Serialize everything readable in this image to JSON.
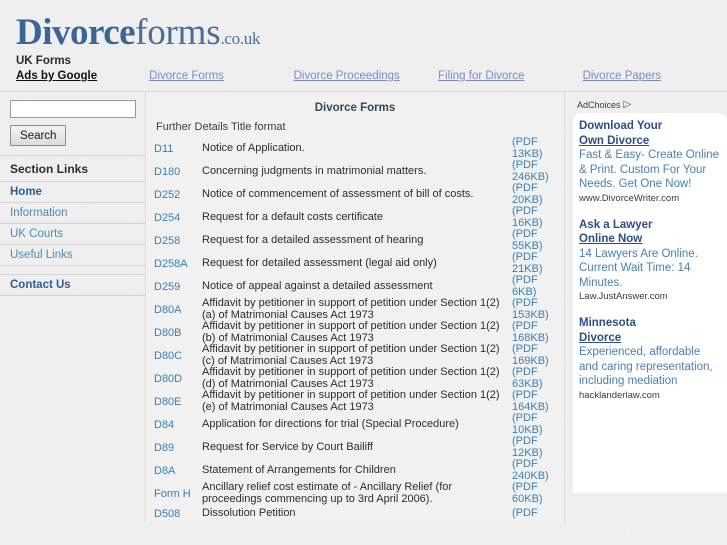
{
  "site": {
    "logo_primary": "Divorce",
    "logo_secondary": "forms",
    "logo_tld": ".co.uk"
  },
  "adnav": {
    "title": "UK Forms",
    "brand": "Ads by Google",
    "links": [
      "Divorce Forms",
      "Divorce Proceedings",
      "Filing for Divorce",
      "Divorce Papers"
    ]
  },
  "sidebar": {
    "search": {
      "value": "",
      "placeholder": "",
      "button_label": "Search"
    },
    "heading": "Section Links",
    "items": [
      {
        "label": "Home",
        "strong": true
      },
      {
        "label": "Information",
        "strong": false
      },
      {
        "label": "UK Courts",
        "strong": false
      },
      {
        "label": "Useful Links",
        "strong": false
      }
    ],
    "contact_label": "Contact Us"
  },
  "main": {
    "title": "Divorce Forms",
    "column_header": "Further Details Title format",
    "rows": [
      {
        "code": "D11",
        "title": "Notice of Application.",
        "size": "(PDF 13KB)"
      },
      {
        "code": "D180",
        "title": "Concerning judgments in matrimonial matters.",
        "size": "(PDF 246KB)"
      },
      {
        "code": "D252",
        "title": "Notice of commencement of assessment of bill of costs.",
        "size": "(PDF 20KB)"
      },
      {
        "code": "D254",
        "title": "Request for a default costs certificate",
        "size": "(PDF 16KB)"
      },
      {
        "code": "D258",
        "title": "Request for a detailed assessment of hearing",
        "size": "(PDF 55KB)"
      },
      {
        "code": "D258A",
        "title": "Request for detailed assessment (legal aid only)",
        "size": "(PDF 21KB)"
      },
      {
        "code": "D259",
        "title": "Notice of appeal against a detailed assessment",
        "size": "(PDF 6KB)"
      },
      {
        "code": "D80A",
        "title": "Affidavit by petitioner in support of petition under Section 1(2)(a) of Matrimonial Causes Act 1973",
        "size": "(PDF 153KB)",
        "two_line": true
      },
      {
        "code": "D80B",
        "title": "Affidavit by petitioner in support of petition under Section 1(2)(b) of Matrimonial Causes Act 1973",
        "size": "(PDF 168KB)",
        "two_line": true
      },
      {
        "code": "D80C",
        "title": "Affidavit by petitioner in support of petition under Section 1(2)(c) of Matrimonial Causes Act 1973",
        "size": "(PDF 169KB)",
        "two_line": true
      },
      {
        "code": "D80D",
        "title": "Affidavit by petitioner in support of petition under Section 1(2)(d) of Matrimonial Causes Act 1973",
        "size": "(PDF 63KB)",
        "two_line": true
      },
      {
        "code": "D80E",
        "title": "Affidavit by petitioner in support of petition under Section 1(2)(e) of Matrimonial Causes Act 1973",
        "size": "(PDF 164KB)",
        "two_line": true
      },
      {
        "code": "D84",
        "title": "Application for directions for trial (Special Procedure)",
        "size": "(PDF 10KB)"
      },
      {
        "code": "D89",
        "title": "Request for Service by Court Bailiff",
        "size": "(PDF 12KB)"
      },
      {
        "code": "D8A",
        "title": "Statement of Arrangements for Children",
        "size": "(PDF 240KB)"
      },
      {
        "code": "Form H",
        "title": "Ancillary relief cost estimate of - Ancillary Relief (for proceedings commencing up to 3rd April 2006).",
        "size": "(PDF 60KB)",
        "two_line": true
      },
      {
        "code": "D508",
        "title": "Dissolution Petition",
        "size": "(PDF"
      }
    ]
  },
  "ads": {
    "adchoices_label": "AdChoices",
    "adchoices_icon": "adchoices-triangle-icon",
    "units": [
      {
        "head_line1": "Download Your",
        "head_line2": "Own Divorce",
        "body": "Fast & Easy- Create Online & Print. Custom For Your Needs. Get One Now!",
        "url": "www.DivorceWriter.com"
      },
      {
        "head_line1": "Ask a Lawyer",
        "head_line2": "Online Now",
        "body": "14 Lawyers Are Online. Current Wait Time: 14 Minutes.",
        "url": "Law.JustAnswer.com"
      },
      {
        "head_line1": "Minnesota",
        "head_line2": "Divorce",
        "body": "Experienced, affordable and caring representation, including mediation",
        "url": "hacklanderlaw.com"
      }
    ]
  },
  "colors": {
    "page_background": "#efefef",
    "logo_blue": "#3a6595",
    "link_blue": "#3a7fb5",
    "ad_head_blue": "#2c4f86",
    "ad_body_blue": "#4b7fae",
    "nav_link_blue": "#7a8cc4"
  }
}
